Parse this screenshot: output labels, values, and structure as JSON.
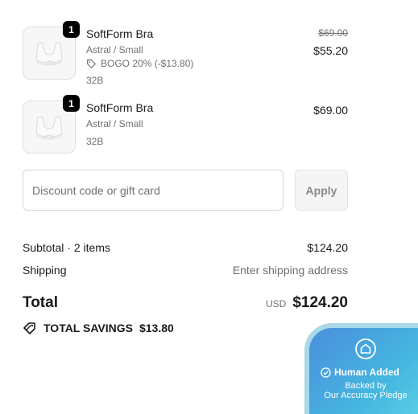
{
  "items": [
    {
      "quantity": "1",
      "name": "SoftForm Bra",
      "variant": "Astral / Small",
      "discount_text": "BOGO 20% (-$13.80)",
      "size": "32B",
      "original_price": "$69.00",
      "price": "$55.20",
      "image_icon": "bra-icon"
    },
    {
      "quantity": "1",
      "name": "SoftForm Bra",
      "variant": "Astral / Small",
      "size": "32B",
      "price": "$69.00",
      "image_icon": "bra-icon"
    }
  ],
  "discount": {
    "placeholder": "Discount code or gift card",
    "apply_label": "Apply"
  },
  "summary": {
    "subtotal_label": "Subtotal · 2 items",
    "subtotal_value": "$124.20",
    "shipping_label": "Shipping",
    "shipping_value": "Enter shipping address",
    "total_label": "Total",
    "currency": "USD",
    "total_value": "$124.20",
    "savings_label": "TOTAL SAVINGS",
    "savings_value": "$13.80"
  },
  "trust_badge": {
    "title": "Human Added",
    "line1": "Backed by",
    "line2": "Our Accuracy Pledge"
  }
}
